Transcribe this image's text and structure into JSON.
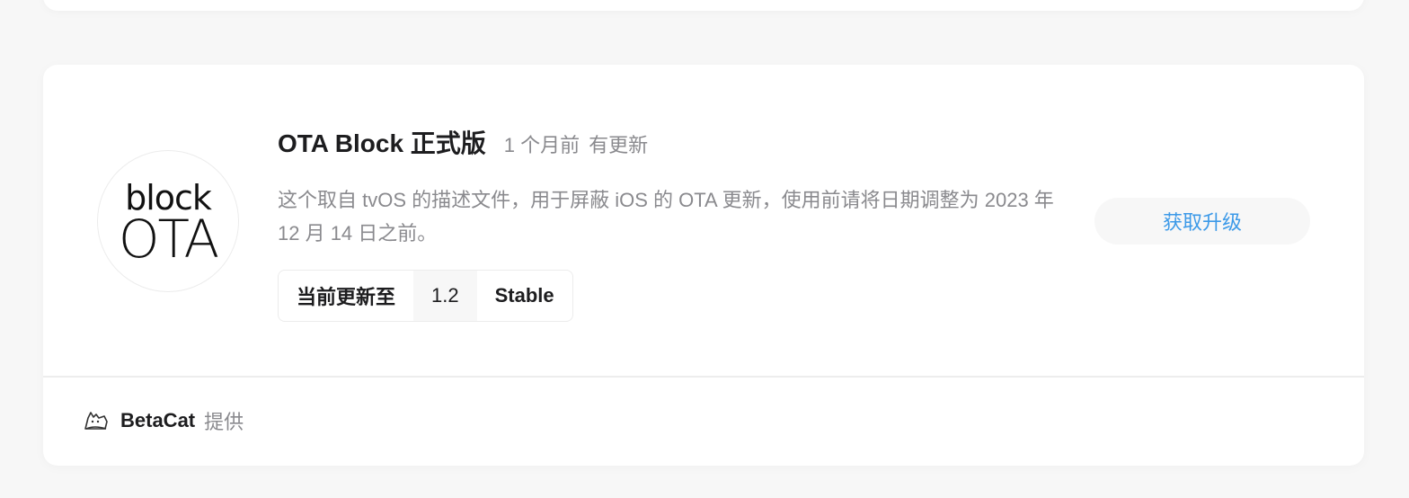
{
  "app": {
    "name": "OTA Block 正式版",
    "logo_line1": "block",
    "logo_line2": "OTA",
    "updated": "1 个月前",
    "update_status": "有更新",
    "description": "这个取自 tvOS 的描述文件，用于屏蔽 iOS 的 OTA 更新，使用前请将日期调整为 2023 年 12 月 14 日之前。"
  },
  "version": {
    "label": "当前更新至",
    "number": "1.2",
    "channel": "Stable"
  },
  "actions": {
    "upgrade_label": "获取升级"
  },
  "footer": {
    "icon": "cat-icon",
    "provider": "BetaCat",
    "provided_label": "提供"
  },
  "colors": {
    "accent": "#3d9ae8",
    "background": "#f7f7f7",
    "text_primary": "#1d1d1f",
    "text_secondary": "#8a8a8e"
  }
}
